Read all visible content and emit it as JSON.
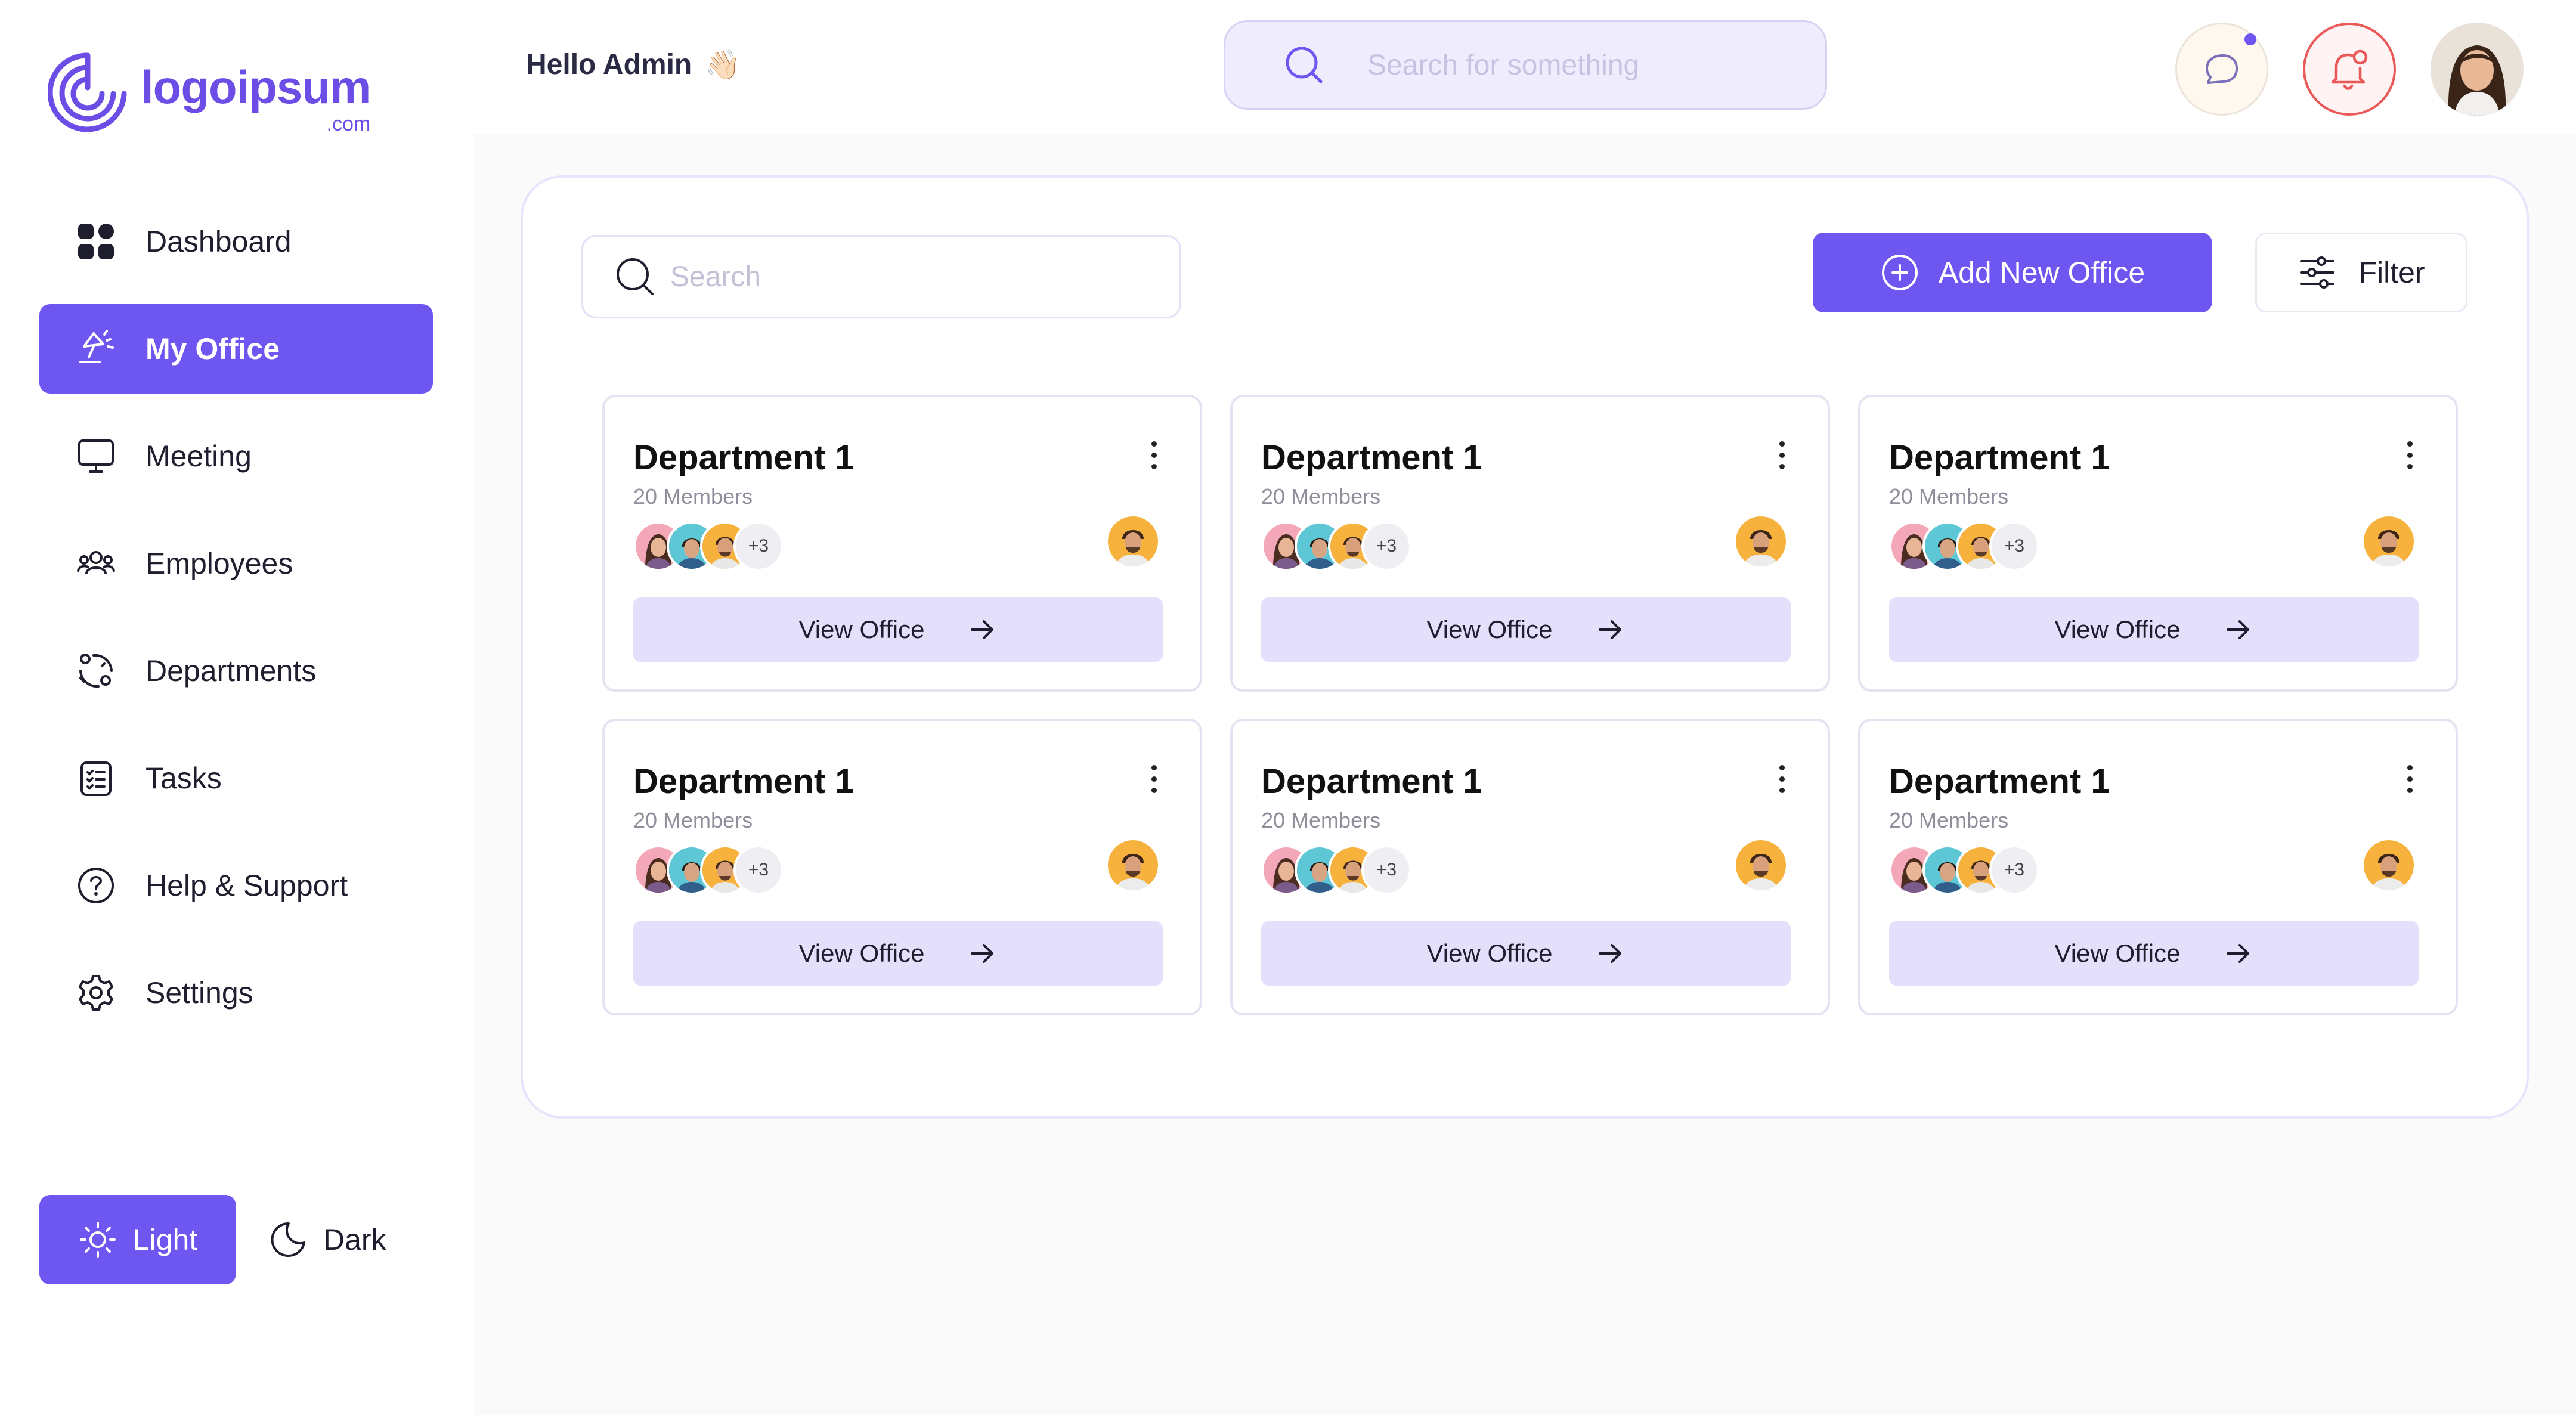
{
  "brand": {
    "name": "logoipsum",
    "domain": ".com",
    "color": "#6c4ee6"
  },
  "header": {
    "greeting": "Hello Admin",
    "greeting_emoji": "👋🏻",
    "search_placeholder": "Search for something"
  },
  "sidebar": {
    "items": [
      {
        "label": "Dashboard",
        "icon": "grid-icon",
        "active": false
      },
      {
        "label": "My Office",
        "icon": "desk-lamp-icon",
        "active": true
      },
      {
        "label": "Meeting",
        "icon": "monitor-icon",
        "active": false
      },
      {
        "label": "Employees",
        "icon": "users-icon",
        "active": false
      },
      {
        "label": "Departments",
        "icon": "org-chart-icon",
        "active": false
      },
      {
        "label": "Tasks",
        "icon": "checklist-icon",
        "active": false
      },
      {
        "label": "Help & Support",
        "icon": "help-icon",
        "active": false
      },
      {
        "label": "Settings",
        "icon": "gear-icon",
        "active": false
      }
    ],
    "theme": {
      "light_label": "Light",
      "dark_label": "Dark",
      "selected": "Light"
    }
  },
  "toolbar": {
    "search_placeholder": "Search",
    "add_label": "Add New Office",
    "filter_label": "Filter"
  },
  "colors": {
    "accent": "#6e56f0",
    "accent_light": "#e4dffb",
    "notification": "#ea5858"
  },
  "departments": [
    {
      "title": "Department 1",
      "members": "20 Members",
      "more": "+3",
      "action": "View Office"
    },
    {
      "title": "Department 1",
      "members": "20 Members",
      "more": "+3",
      "action": "View Office"
    },
    {
      "title": "Department 1",
      "members": "20 Members",
      "more": "+3",
      "action": "View Office"
    },
    {
      "title": "Department 1",
      "members": "20 Members",
      "more": "+3",
      "action": "View Office"
    },
    {
      "title": "Department 1",
      "members": "20 Members",
      "more": "+3",
      "action": "View Office"
    },
    {
      "title": "Department 1",
      "members": "20 Members",
      "more": "+3",
      "action": "View Office"
    }
  ]
}
